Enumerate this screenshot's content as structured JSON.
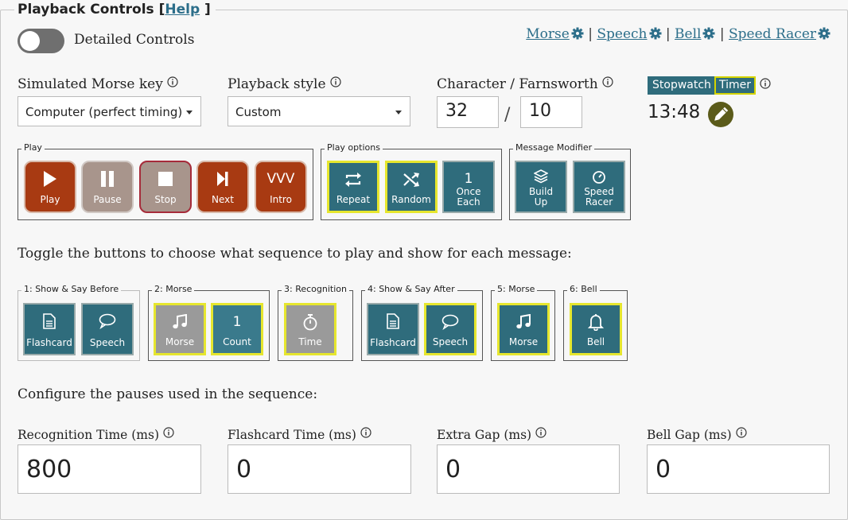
{
  "panel": {
    "title": "Playback Controls",
    "help_open": "[",
    "help_link": "Help",
    "help_close": "]"
  },
  "detailed_toggle": {
    "label": "Detailed Controls",
    "on": false
  },
  "top_links": [
    {
      "label": "Morse"
    },
    {
      "label": "Speech"
    },
    {
      "label": "Bell"
    },
    {
      "label": "Speed Racer"
    }
  ],
  "top_link_separator": "|",
  "morse_key": {
    "label": "Simulated Morse key",
    "value": "Computer (perfect timing)"
  },
  "playback_style": {
    "label": "Playback style",
    "value": "Custom"
  },
  "speed": {
    "label": "Character / Farnsworth",
    "character": "32",
    "separator": "/",
    "farnsworth": "10"
  },
  "timer": {
    "stopwatch_label": "Stopwatch",
    "timer_label": "Timer",
    "selected": "Timer",
    "time": "13:48"
  },
  "play_group": {
    "title": "Play",
    "buttons": [
      {
        "label": "Play",
        "icon": "play-icon"
      },
      {
        "label": "Pause",
        "icon": "pause-icon"
      },
      {
        "label": "Stop",
        "icon": "stop-icon"
      },
      {
        "label": "Next",
        "icon": "next-icon"
      },
      {
        "label": "Intro",
        "icon": "vvv-icon",
        "icon_text": "VVV"
      }
    ]
  },
  "play_options": {
    "title": "Play options",
    "buttons": [
      {
        "label": "Repeat",
        "icon": "repeat-icon",
        "on": true
      },
      {
        "label": "Random",
        "icon": "shuffle-icon",
        "on": true
      },
      {
        "label": "Once Each",
        "line1": "Once",
        "line2": "Each",
        "icon_text": "1",
        "on": false
      }
    ]
  },
  "message_modifier": {
    "title": "Message Modifier",
    "buttons": [
      {
        "label": "Build Up",
        "line1": "Build",
        "line2": "Up",
        "icon": "layers-icon"
      },
      {
        "label": "Speed Racer",
        "line1": "Speed",
        "line2": "Racer",
        "icon": "speedometer-icon"
      }
    ]
  },
  "sequence_intro": "Toggle the buttons to choose what sequence to play and show for each message:",
  "sequence": [
    {
      "title": "1: Show & Say Before",
      "buttons": [
        {
          "label": "Flashcard",
          "icon": "document-icon",
          "on": false
        },
        {
          "label": "Speech",
          "icon": "speech-bubble-icon",
          "on": false
        }
      ]
    },
    {
      "title": "2: Morse",
      "buttons": [
        {
          "label": "Morse",
          "icon": "music-note-icon",
          "on": true,
          "muted": true
        },
        {
          "label": "Count",
          "icon_text": "1",
          "on": true
        }
      ]
    },
    {
      "title": "3: Recognition",
      "buttons": [
        {
          "label": "Time",
          "icon": "stopwatch-icon",
          "on": true,
          "muted": true
        }
      ]
    },
    {
      "title": "4: Show & Say After",
      "buttons": [
        {
          "label": "Flashcard",
          "icon": "document-icon",
          "on": false
        },
        {
          "label": "Speech",
          "icon": "speech-bubble-icon",
          "on": true
        }
      ]
    },
    {
      "title": "5: Morse",
      "buttons": [
        {
          "label": "Morse",
          "icon": "music-note-icon",
          "on": true
        }
      ]
    },
    {
      "title": "6: Bell",
      "buttons": [
        {
          "label": "Bell",
          "icon": "bell-icon",
          "on": true
        }
      ]
    }
  ],
  "pauses_intro": "Configure the pauses used in the sequence:",
  "pauses": [
    {
      "label": "Recognition Time (ms)",
      "value": "800"
    },
    {
      "label": "Flashcard Time (ms)",
      "value": "0"
    },
    {
      "label": "Extra Gap (ms)",
      "value": "0"
    },
    {
      "label": "Bell Gap (ms)",
      "value": "0"
    }
  ],
  "colors": {
    "orange": "#a83a12",
    "teal": "#2f6c7c",
    "highlight": "#e6e62e",
    "link": "#2c6e8a"
  }
}
